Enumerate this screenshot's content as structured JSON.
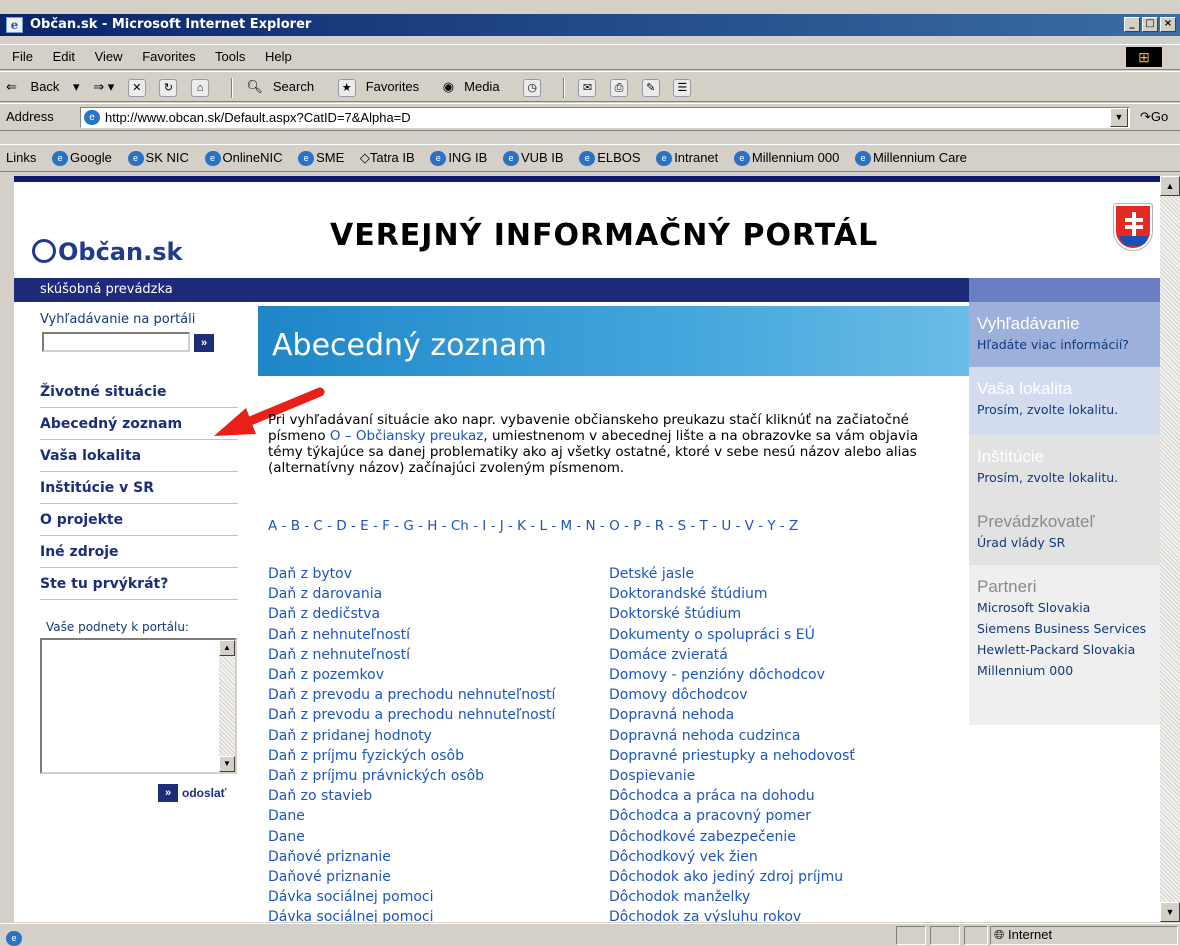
{
  "window": {
    "title": "Občan.sk - Microsoft Internet Explorer",
    "icon": "ie-icon"
  },
  "menu": [
    "File",
    "Edit",
    "View",
    "Favorites",
    "Tools",
    "Help"
  ],
  "toolbar": {
    "back": "Back",
    "search": "Search",
    "favorites": "Favorites",
    "media": "Media"
  },
  "address": {
    "label": "Address",
    "url": "http://www.obcan.sk/Default.aspx?CatID=7&Alpha=D",
    "go": "Go"
  },
  "links": {
    "label": "Links",
    "items": [
      "Google",
      "SK NIC",
      "OnlineNIC",
      "SME",
      "Tatra IB",
      "ING IB",
      "VUB IB",
      "ELBOS",
      "Intranet",
      "Millennium 000",
      "Millennium Care"
    ]
  },
  "header": {
    "logo": "Občan.sk",
    "title": "VEREJNÝ INFORMAČNÝ PORTÁL",
    "subtitle": "skúšobná prevádzka"
  },
  "left": {
    "search_label": "Vyhľadávanie na portáli",
    "nav": [
      "Životné situácie",
      "Abecedný zoznam",
      "Vaša lokalita",
      "Inštitúcie v SR",
      "O projekte",
      "Iné zdroje",
      "Ste tu prvýkrát?"
    ],
    "feedback_label": "Vaše podnety k portálu:",
    "send": "odoslať"
  },
  "main": {
    "title": "Abecedný zoznam",
    "intro_1": "Pri vyhľadávaní situácie ako napr. vybavenie občianskeho preukazu stačí kliknúť na začiatočné písmeno ",
    "intro_link": "O – Občiansky preukaz",
    "intro_2": ", umiestnenom v abecednej lište a na obrazovke sa vám objavia témy týkajúce sa danej problematiky ako aj všetky ostatné, ktoré v sebe nesú názov alebo alias (alternatívny názov) začínajúci zvoleným písmenom.",
    "alphabet": "A - B - C - D - E - F - G - H - Ch - I - J - K - L - M - N - O - P - R - S - T - U - V - Y - Z",
    "col1": [
      "Daň z bytov",
      "Daň z darovania",
      "Daň z dedičstva",
      "Daň z nehnuteľností",
      "Daň z nehnuteľností",
      "Daň z pozemkov",
      "Daň z prevodu a prechodu nehnuteľností",
      "Daň z prevodu a prechodu nehnuteľností",
      "Daň z pridanej hodnoty",
      "Daň z príjmu fyzických osôb",
      "Daň z príjmu právnických osôb",
      "Daň zo stavieb",
      "Dane",
      "Dane",
      "Daňové priznanie",
      "Daňové priznanie",
      "Dávka sociálnej pomoci",
      "Dávka sociálnej pomoci"
    ],
    "col2": [
      "Detské jasle",
      "Doktorandské štúdium",
      "Doktorské štúdium",
      "Dokumenty o spolupráci s EÚ",
      "Domáce zvieratá",
      "Domovy - penzióny dôchodcov",
      "Domovy dôchodcov",
      "Dopravná nehoda",
      "Dopravná nehoda cudzinca",
      "Dopravné priestupky a nehodovosť",
      "Dospievanie",
      "Dôchodca a práca na dohodu",
      "Dôchodca a pracovný pomer",
      "Dôchodkové zabezpečenie",
      "Dôchodkový vek žien",
      "Dôchodok ako jediný zdroj príjmu",
      "Dôchodok manželky",
      "Dôchodok za výsluhu rokov"
    ]
  },
  "right": {
    "s1_h": "Vyhľadávanie",
    "s1_l": "Hľadáte viac informácií?",
    "s2_h": "Vaša lokalita",
    "s2_l": "Prosím, zvolte lokalitu.",
    "s3_h": "Inštitúcie",
    "s3_l": "Prosím, zvolte lokalitu.",
    "s4_h": "Prevádzkovateľ",
    "s4_l": "Úrad vlády SR",
    "s5_h": "Partneri",
    "partners": [
      "Microsoft Slovakia",
      "Siemens Business Services",
      "Hewlett-Packard Slovakia",
      "Millennium 000"
    ]
  },
  "status": {
    "zone": "Internet"
  }
}
